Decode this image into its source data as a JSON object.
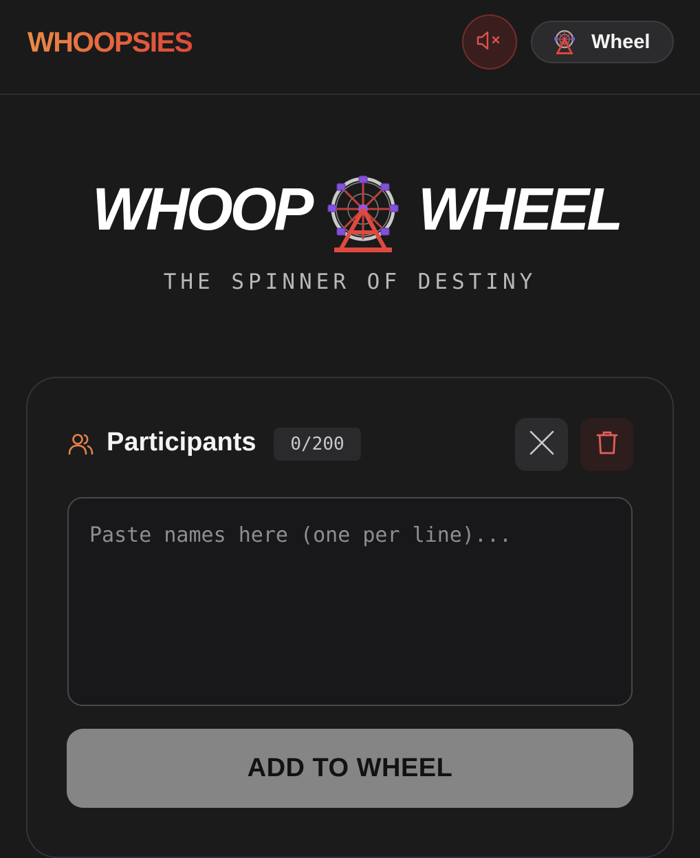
{
  "header": {
    "brand": "WHOOPSIES",
    "mute_icon": "speaker-muted-icon",
    "wheel_button_icon": "ferris-wheel-icon",
    "wheel_button_label": "Wheel"
  },
  "hero": {
    "title_left": "WHOOP",
    "title_icon": "ferris-wheel-icon",
    "title_right": "WHEEL",
    "tagline": "THE SPINNER OF DESTINY"
  },
  "participants": {
    "icon": "users-icon",
    "title": "Participants",
    "count": "0/200",
    "clear_icon": "close-icon",
    "delete_icon": "trash-icon",
    "input_value": "",
    "input_placeholder": "Paste names here (one per line)...",
    "add_button_label": "ADD TO WHEEL"
  },
  "colors": {
    "brand_gradient_start": "#ea8a48",
    "brand_gradient_end": "#dc4b39",
    "accent_orange": "#e8834a",
    "danger_red": "#e0605a",
    "background": "#1a1a1b",
    "button_disabled": "#858585"
  }
}
